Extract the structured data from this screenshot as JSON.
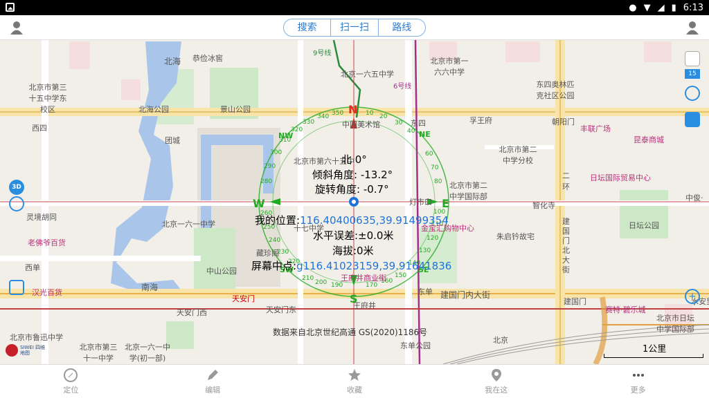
{
  "status_bar": {
    "time": "6:13"
  },
  "top_bar": {
    "tabs": [
      "搜索",
      "扫一扫",
      "路线"
    ]
  },
  "map": {
    "labels": [
      "北海",
      "恭俭冰窖",
      "北京一六五中学",
      "北京市第一六六中学",
      "北京市第三十五中学东校区",
      "北海公园",
      "景山公园",
      "东四奥林匹克社区公园",
      "孚王府",
      "东四",
      "朝阳门",
      "丰联广场",
      "昆泰商城",
      "西四",
      "团城",
      "中国美术馆",
      "北京市第二中学分校",
      "北京市第六十五中",
      "日坛国际贸易中心",
      "灯市口",
      "北京市第二中学国际部",
      "智化寺",
      "灵境胡同",
      "北京一六一中学",
      "十七中学",
      "金宝汇购物中心",
      "朱启钤故宅",
      "建国门北大街",
      "日坛公园",
      "老佛爷百货",
      "藏珍阁",
      "中山公园",
      "西单",
      "汉光百货",
      "南海",
      "王府井商业街",
      "东单",
      "建国门内大街",
      "赛特·碧乐城",
      "建国门",
      "天安门",
      "天安门东",
      "天安门西",
      "王府井",
      "北京市日坛中学国际部",
      "北京市鲁迅中学",
      "北京市第三十一中学",
      "北京一六一中学(初一部)",
      "北京",
      "东单公园",
      "1公里",
      "二环",
      "中俊·",
      "水安里",
      "6号线",
      "9号线",
      "15"
    ],
    "side_badge": "15"
  },
  "compass": {
    "north_line": "北 0°",
    "tilt": "倾斜角度: -13.2°",
    "rotation": "旋转角度: -0.7°",
    "my_location_label": "我的位置:",
    "my_location_value": "116.40400635,39.91499354",
    "horizontal_error": "水平误差:±0.0米",
    "altitude": "海拔:0米",
    "screen_center_label": "屏幕中点:",
    "screen_center_value": "g116.41023159,39.91641836",
    "ring_letters": [
      "N",
      "E",
      "S",
      "W",
      "NE",
      "NW",
      "SE",
      "SW"
    ],
    "ring_degrees": [
      "350",
      "10",
      "20",
      "30",
      "40",
      "340",
      "330",
      "320",
      "310",
      "300",
      "290",
      "280",
      "260",
      "250",
      "240",
      "230",
      "220",
      "210",
      "200",
      "190",
      "170",
      "160",
      "150",
      "140",
      "130",
      "120",
      "110",
      "100",
      "80",
      "70",
      "60"
    ]
  },
  "attribution": "数据来自北京世纪高通 GS(2020)1186号",
  "logo_text": "SIWEI 四维地图",
  "bottom_nav": {
    "items": [
      "定位",
      "编辑",
      "收藏",
      "我在这",
      "更多"
    ]
  },
  "colors": {
    "accent": "#2b7bd0",
    "compass": "#22aa22",
    "compass_red": "#e03020"
  }
}
